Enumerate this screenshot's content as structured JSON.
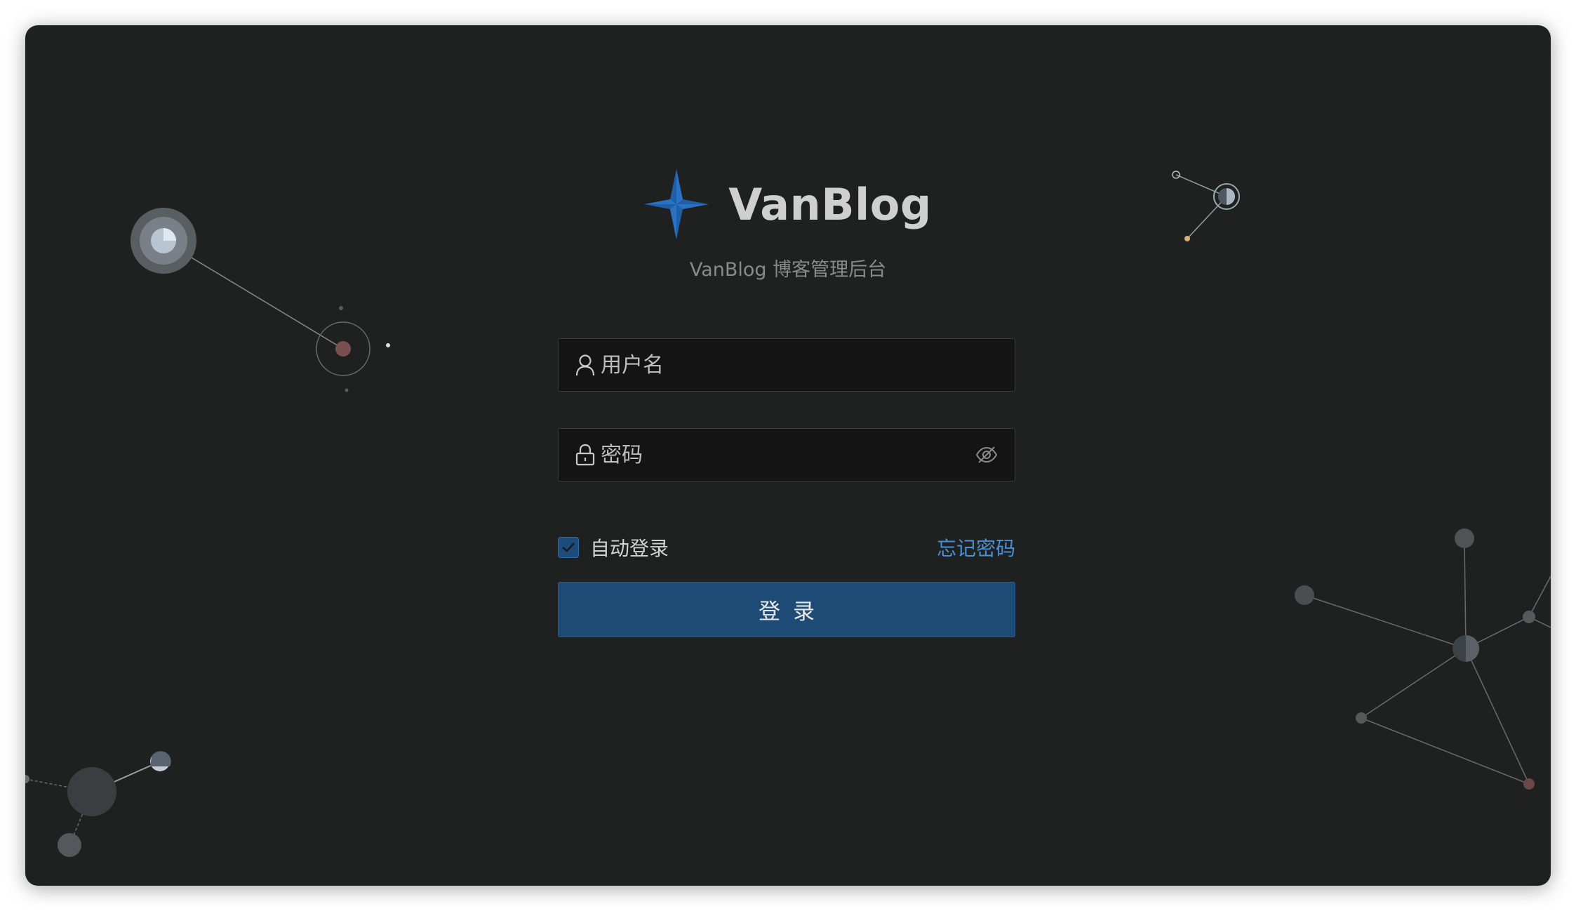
{
  "brand": {
    "title": "VanBlog",
    "subtitle": "VanBlog 博客管理后台",
    "logo_icon": "four-point-star-icon",
    "logo_color": "#1f5fa8"
  },
  "login_form": {
    "username": {
      "placeholder": "用户名",
      "value": "",
      "icon": "user-icon"
    },
    "password": {
      "placeholder": "密码",
      "value": "",
      "icon": "lock-icon",
      "toggle_icon": "eye-off-icon"
    },
    "remember": {
      "label": "自动登录",
      "checked": true
    },
    "forgot_label": "忘记密码",
    "submit_label": "登录"
  },
  "colors": {
    "background": "#1f2020",
    "accent": "#1e4a76",
    "link": "#4a90d9"
  }
}
